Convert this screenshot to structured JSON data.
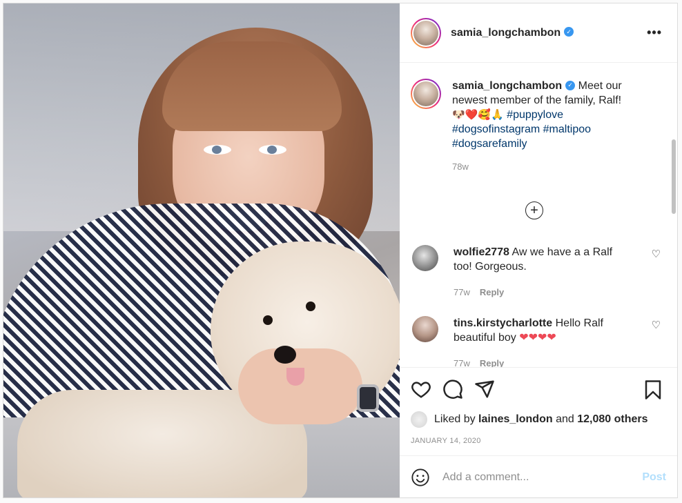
{
  "post": {
    "username": "samia_longchambon",
    "more_label": "•••",
    "verified_mark": "✓"
  },
  "caption": {
    "username": "samia_longchambon",
    "text": "Meet our newest member of the family, Ralf!",
    "emojis": "🐶❤️🥰🙏",
    "hashtags": [
      "#puppylove",
      "#dogsofinstagram",
      "#maltipoo",
      "#dogsarefamily"
    ],
    "time": "78w"
  },
  "load_more_label": "+",
  "comments": [
    {
      "username": "wolfie2778",
      "text": "Aw we have a a Ralf too! Gorgeous.",
      "time": "77w",
      "reply": "Reply"
    },
    {
      "username": "tins.kirstycharlotte",
      "text": "Hello Ralf beautiful boy",
      "hearts": "❤❤❤❤",
      "time": "77w",
      "reply": "Reply"
    }
  ],
  "actions": {
    "icons": [
      "heart-icon",
      "comment-icon",
      "share-icon",
      "bookmark-icon"
    ]
  },
  "likes": {
    "prefix": "Liked by",
    "user": "laines_london",
    "middle": "and",
    "count": "12,080 others"
  },
  "date": "JANUARY 14, 2020",
  "add_comment": {
    "placeholder": "Add a comment...",
    "post_label": "Post"
  },
  "colors": {
    "link": "#00376b",
    "verified": "#3897f0",
    "post_button": "#b2dffc",
    "heart": "#ed4956"
  }
}
